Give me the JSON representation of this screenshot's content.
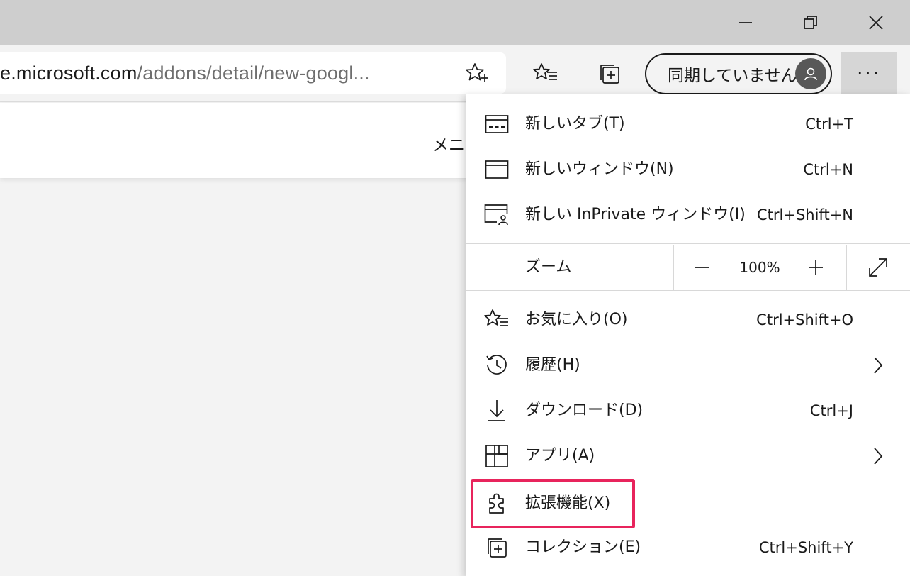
{
  "window_controls": {
    "minimize_icon": "minimize-icon",
    "restore_icon": "restore-icon",
    "close_icon": "close-icon"
  },
  "address_bar": {
    "url_host": "e.microsoft.com",
    "url_path": "/addons/detail/new-googl..."
  },
  "toolbar": {
    "sync_label": "同期していません",
    "more_label": "···"
  },
  "page": {
    "menu_text": "メニュー"
  },
  "menu": {
    "new_tab": {
      "label": "新しいタブ(T)",
      "shortcut": "Ctrl+T"
    },
    "new_window": {
      "label": "新しいウィンドウ(N)",
      "shortcut": "Ctrl+N"
    },
    "new_inprivate": {
      "label": "新しい InPrivate ウィンドウ(I)",
      "shortcut": "Ctrl+Shift+N"
    },
    "zoom": {
      "label": "ズーム",
      "value": "100%"
    },
    "favorites": {
      "label": "お気に入り(O)",
      "shortcut": "Ctrl+Shift+O"
    },
    "history": {
      "label": "履歴(H)"
    },
    "downloads": {
      "label": "ダウンロード(D)",
      "shortcut": "Ctrl+J"
    },
    "apps": {
      "label": "アプリ(A)"
    },
    "extensions": {
      "label": "拡張機能(X)"
    },
    "collections": {
      "label": "コレクション(E)",
      "shortcut": "Ctrl+Shift+Y"
    }
  },
  "colors": {
    "highlight": "#e8245c",
    "titlebar": "#cecece",
    "toolbar": "#f3f3f3",
    "avatar": "#585858"
  }
}
